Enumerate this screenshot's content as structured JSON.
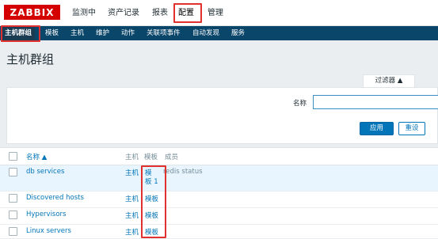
{
  "brand": {
    "logo_text": "ZABBIX",
    "accent": "#d40000"
  },
  "top_menu": [
    {
      "label": "监测中"
    },
    {
      "label": "资产记录"
    },
    {
      "label": "报表"
    },
    {
      "label": "配置"
    },
    {
      "label": "管理"
    }
  ],
  "sub_menu": [
    {
      "label": "主机群组"
    },
    {
      "label": "模板"
    },
    {
      "label": "主机"
    },
    {
      "label": "维护"
    },
    {
      "label": "动作"
    },
    {
      "label": "关联项事件"
    },
    {
      "label": "自动发现"
    },
    {
      "label": "服务"
    }
  ],
  "page": {
    "title": "主机群组"
  },
  "filter": {
    "tab_label": "过滤器 ▲",
    "name_label": "名称",
    "name_value": "",
    "apply_label": "应用",
    "reset_label": "重设"
  },
  "table": {
    "headers": {
      "name": "名称 ▲",
      "hosts": "主机",
      "templates": "模板",
      "members": "成员"
    },
    "rows": [
      {
        "name": "db services",
        "hosts": "主机",
        "templates_line1": "模",
        "templates_line2": "板 1",
        "members": "redis status"
      },
      {
        "name": "Discovered hosts",
        "hosts": "主机",
        "templates": "模板"
      },
      {
        "name": "Hypervisors",
        "hosts": "主机",
        "templates": "模板"
      },
      {
        "name": "Linux servers",
        "hosts": "主机",
        "templates": "模板"
      }
    ]
  },
  "colors": {
    "nav_bg": "#0a466a",
    "link": "#0275b8",
    "highlight": "#e03030"
  }
}
